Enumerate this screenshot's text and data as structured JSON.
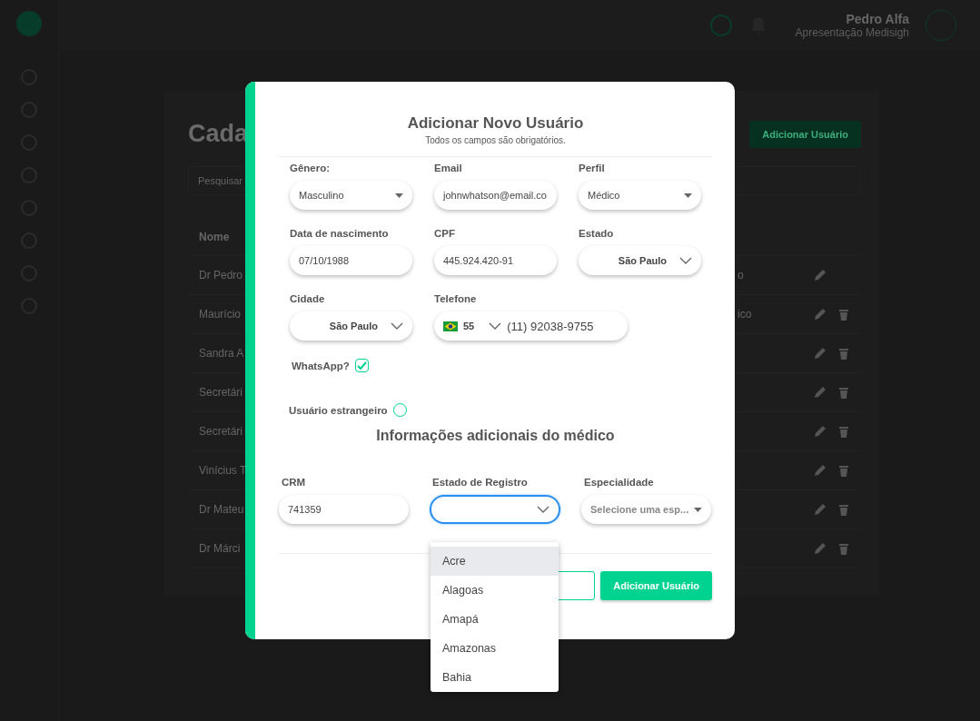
{
  "header": {
    "user_name": "Pedro Alfa",
    "user_subtitle": "Apresentação Medisigh"
  },
  "page": {
    "title": "Cada",
    "search_placeholder": "Pesquisar",
    "add_button": "Adicionar Usuário",
    "table": {
      "columns": [
        "Nome"
      ],
      "rows": [
        {
          "name": "Dr Pedro",
          "column_2": "o",
          "deletable": false
        },
        {
          "name": "Maurício",
          "column_2": "ico",
          "deletable": true
        },
        {
          "name": "Sandra A",
          "deletable": true
        },
        {
          "name": "Secretári",
          "deletable": true
        },
        {
          "name": "Secretári",
          "deletable": true
        },
        {
          "name": "Vinícius T",
          "deletable": true
        },
        {
          "name": "Dr Mateu",
          "deletable": true
        },
        {
          "name": "Dr Márci",
          "deletable": true
        }
      ]
    }
  },
  "modal": {
    "title": "Adicionar Novo Usuário",
    "subtitle": "Todos os campos são obrigatórios.",
    "fields": [
      {
        "label": "Gênero:",
        "kind": "select",
        "value": "Masculino"
      },
      {
        "label": "Email",
        "kind": "input",
        "value": "johnwhatson@email.co"
      },
      {
        "label": "Perfil",
        "kind": "select",
        "value": "Médico"
      },
      {
        "label": "Data de nascimento",
        "kind": "input",
        "value": "07/10/1988"
      },
      {
        "label": "CPF",
        "kind": "input",
        "value": "445.924.420-91"
      },
      {
        "label": "Estado",
        "kind": "combo",
        "value": "São Paulo"
      },
      {
        "label": "Cidade",
        "kind": "combo",
        "value": "São Paulo"
      },
      {
        "label": "Telefone",
        "kind": "phone",
        "code": "55",
        "value": "(11) 92038-9755"
      }
    ],
    "whatsapp": {
      "label": "WhatsApp?",
      "checked": true
    },
    "foreign": {
      "label": "Usuário estrangeiro",
      "checked": false
    },
    "section_title": "Informações adicionais do médico",
    "doctor_fields": [
      {
        "label": "CRM",
        "kind": "input",
        "value": "741359"
      },
      {
        "label": "Estado de Registro",
        "kind": "combo",
        "focused": true
      },
      {
        "label": "Especialidade",
        "kind": "select",
        "placeholder": "Selecione uma esp..."
      }
    ],
    "dropdown": {
      "options": [
        {
          "label": "Acre",
          "selected": true
        },
        {
          "label": "Alagoas",
          "selected": false
        },
        {
          "label": "Amapá",
          "selected": false
        },
        {
          "label": "Amazonas",
          "selected": false
        },
        {
          "label": "Bahia",
          "selected": false
        }
      ]
    },
    "buttons": [
      {
        "kind": "outline"
      },
      {
        "kind": "primary",
        "label": "Adicionar Usuário"
      }
    ]
  }
}
